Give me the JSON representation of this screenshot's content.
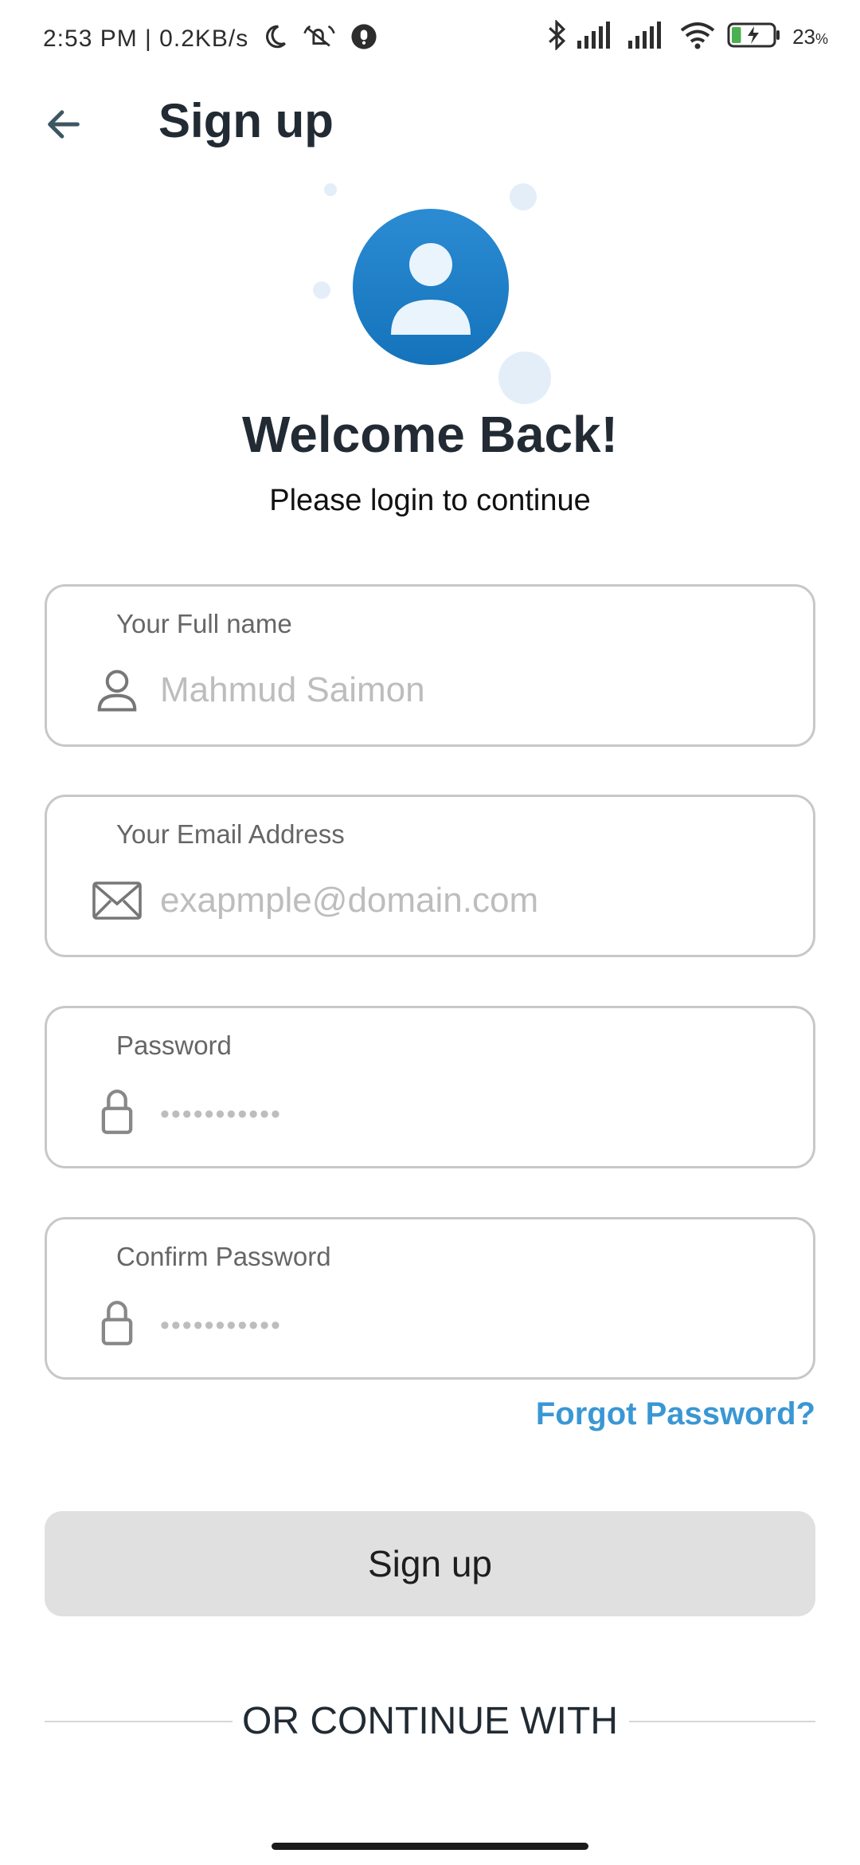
{
  "status_bar": {
    "time_and_speed": "2:53 PM | 0.2KB/s",
    "battery_percent": "23",
    "battery_unit": "%",
    "battery_level": 0.23,
    "icons": [
      "moon-icon",
      "notifications-off-icon",
      "app-badge-icon",
      "bluetooth-icon",
      "signal-icon",
      "signal-icon",
      "wifi-icon",
      "battery-charging-icon"
    ]
  },
  "header": {
    "back_icon": "arrow-left-icon",
    "title": "Sign up"
  },
  "hero": {
    "avatar_icon": "user-avatar-icon",
    "headline": "Welcome Back!",
    "subtitle": "Please login to continue"
  },
  "form": {
    "full_name": {
      "label": "Your Full name",
      "placeholder": "Mahmud Saimon",
      "icon": "person-icon"
    },
    "email": {
      "label": "Your Email Address",
      "placeholder": "exapmple@domain.com",
      "icon": "mail-icon"
    },
    "password": {
      "label": "Password",
      "placeholder": "•••••••••••",
      "icon": "lock-icon"
    },
    "confirm_password": {
      "label": "Confirm Password",
      "placeholder": "•••••••••••",
      "icon": "lock-icon"
    },
    "forgot_password": "Forgot Password?",
    "submit_label": "Sign up",
    "divider_text": "OR CONTINUE WITH"
  },
  "colors": {
    "accent": "#3a97d4",
    "avatar_blue": "#1d7ec6",
    "title_text": "#222b33",
    "field_border": "#c8c8c8",
    "button_bg": "#e0e0e0"
  }
}
